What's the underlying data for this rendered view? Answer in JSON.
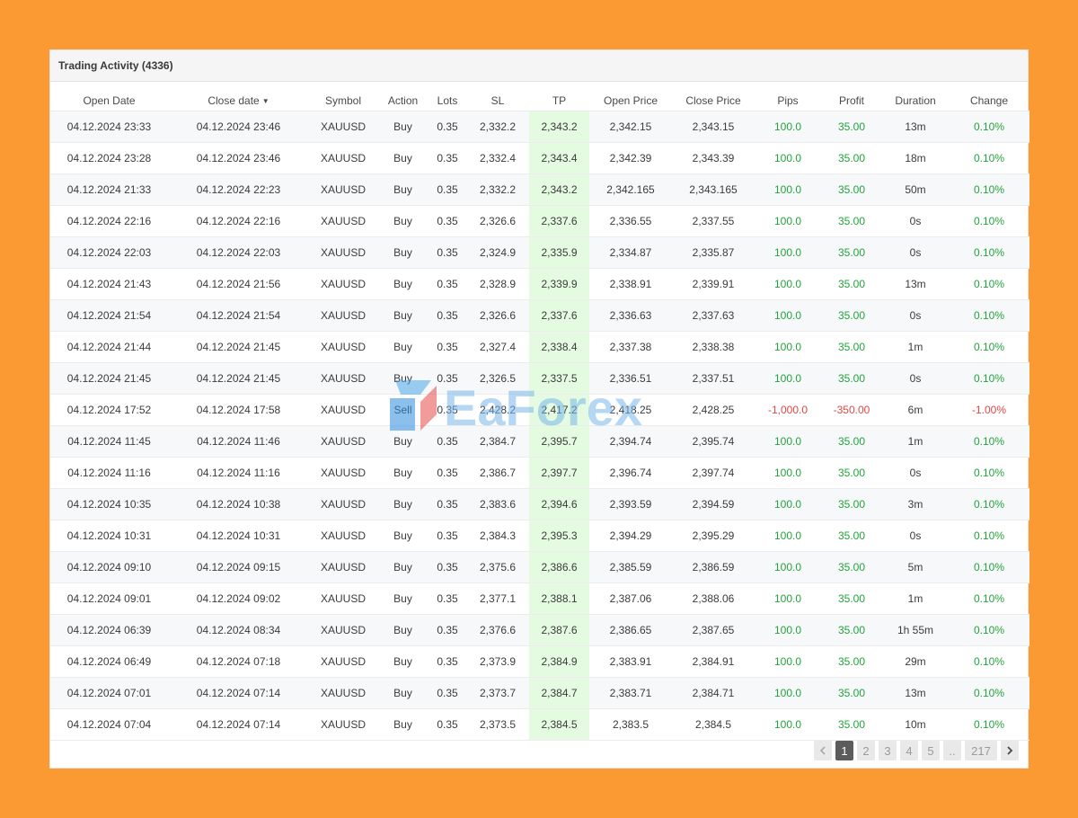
{
  "panel": {
    "title": "Trading Activity (4336)"
  },
  "table": {
    "columns": [
      "Open Date",
      "Close date",
      "Symbol",
      "Action",
      "Lots",
      "SL",
      "TP",
      "Open Price",
      "Close Price",
      "Pips",
      "Profit",
      "Duration",
      "Change"
    ],
    "sort_indicator": "▼",
    "rows": [
      [
        "04.12.2024 23:33",
        "04.12.2024 23:46",
        "XAUUSD",
        "Buy",
        "0.35",
        "2,332.2",
        "2,343.2",
        "2,342.15",
        "2,343.15",
        "100.0",
        "35.00",
        "13m",
        "0.10%"
      ],
      [
        "04.12.2024 23:28",
        "04.12.2024 23:46",
        "XAUUSD",
        "Buy",
        "0.35",
        "2,332.4",
        "2,343.4",
        "2,342.39",
        "2,343.39",
        "100.0",
        "35.00",
        "18m",
        "0.10%"
      ],
      [
        "04.12.2024 21:33",
        "04.12.2024 22:23",
        "XAUUSD",
        "Buy",
        "0.35",
        "2,332.2",
        "2,343.2",
        "2,342.165",
        "2,343.165",
        "100.0",
        "35.00",
        "50m",
        "0.10%"
      ],
      [
        "04.12.2024 22:16",
        "04.12.2024 22:16",
        "XAUUSD",
        "Buy",
        "0.35",
        "2,326.6",
        "2,337.6",
        "2,336.55",
        "2,337.55",
        "100.0",
        "35.00",
        "0s",
        "0.10%"
      ],
      [
        "04.12.2024 22:03",
        "04.12.2024 22:03",
        "XAUUSD",
        "Buy",
        "0.35",
        "2,324.9",
        "2,335.9",
        "2,334.87",
        "2,335.87",
        "100.0",
        "35.00",
        "0s",
        "0.10%"
      ],
      [
        "04.12.2024 21:43",
        "04.12.2024 21:56",
        "XAUUSD",
        "Buy",
        "0.35",
        "2,328.9",
        "2,339.9",
        "2,338.91",
        "2,339.91",
        "100.0",
        "35.00",
        "13m",
        "0.10%"
      ],
      [
        "04.12.2024 21:54",
        "04.12.2024 21:54",
        "XAUUSD",
        "Buy",
        "0.35",
        "2,326.6",
        "2,337.6",
        "2,336.63",
        "2,337.63",
        "100.0",
        "35.00",
        "0s",
        "0.10%"
      ],
      [
        "04.12.2024 21:44",
        "04.12.2024 21:45",
        "XAUUSD",
        "Buy",
        "0.35",
        "2,327.4",
        "2,338.4",
        "2,337.38",
        "2,338.38",
        "100.0",
        "35.00",
        "1m",
        "0.10%"
      ],
      [
        "04.12.2024 21:45",
        "04.12.2024 21:45",
        "XAUUSD",
        "Buy",
        "0.35",
        "2,326.5",
        "2,337.5",
        "2,336.51",
        "2,337.51",
        "100.0",
        "35.00",
        "0s",
        "0.10%"
      ],
      [
        "04.12.2024 17:52",
        "04.12.2024 17:58",
        "XAUUSD",
        "Sell",
        "0.35",
        "2,428.2",
        "2,417.2",
        "2,418.25",
        "2,428.25",
        "-1,000.0",
        "-350.00",
        "6m",
        "-1.00%"
      ],
      [
        "04.12.2024 11:45",
        "04.12.2024 11:46",
        "XAUUSD",
        "Buy",
        "0.35",
        "2,384.7",
        "2,395.7",
        "2,394.74",
        "2,395.74",
        "100.0",
        "35.00",
        "1m",
        "0.10%"
      ],
      [
        "04.12.2024 11:16",
        "04.12.2024 11:16",
        "XAUUSD",
        "Buy",
        "0.35",
        "2,386.7",
        "2,397.7",
        "2,396.74",
        "2,397.74",
        "100.0",
        "35.00",
        "0s",
        "0.10%"
      ],
      [
        "04.12.2024 10:35",
        "04.12.2024 10:38",
        "XAUUSD",
        "Buy",
        "0.35",
        "2,383.6",
        "2,394.6",
        "2,393.59",
        "2,394.59",
        "100.0",
        "35.00",
        "3m",
        "0.10%"
      ],
      [
        "04.12.2024 10:31",
        "04.12.2024 10:31",
        "XAUUSD",
        "Buy",
        "0.35",
        "2,384.3",
        "2,395.3",
        "2,394.29",
        "2,395.29",
        "100.0",
        "35.00",
        "0s",
        "0.10%"
      ],
      [
        "04.12.2024 09:10",
        "04.12.2024 09:15",
        "XAUUSD",
        "Buy",
        "0.35",
        "2,375.6",
        "2,386.6",
        "2,385.59",
        "2,386.59",
        "100.0",
        "35.00",
        "5m",
        "0.10%"
      ],
      [
        "04.12.2024 09:01",
        "04.12.2024 09:02",
        "XAUUSD",
        "Buy",
        "0.35",
        "2,377.1",
        "2,388.1",
        "2,387.06",
        "2,388.06",
        "100.0",
        "35.00",
        "1m",
        "0.10%"
      ],
      [
        "04.12.2024 06:39",
        "04.12.2024 08:34",
        "XAUUSD",
        "Buy",
        "0.35",
        "2,376.6",
        "2,387.6",
        "2,386.65",
        "2,387.65",
        "100.0",
        "35.00",
        "1h 55m",
        "0.10%"
      ],
      [
        "04.12.2024 06:49",
        "04.12.2024 07:18",
        "XAUUSD",
        "Buy",
        "0.35",
        "2,373.9",
        "2,384.9",
        "2,383.91",
        "2,384.91",
        "100.0",
        "35.00",
        "29m",
        "0.10%"
      ],
      [
        "04.12.2024 07:01",
        "04.12.2024 07:14",
        "XAUUSD",
        "Buy",
        "0.35",
        "2,373.7",
        "2,384.7",
        "2,383.71",
        "2,384.71",
        "100.0",
        "35.00",
        "13m",
        "0.10%"
      ],
      [
        "04.12.2024 07:04",
        "04.12.2024 07:14",
        "XAUUSD",
        "Buy",
        "0.35",
        "2,373.5",
        "2,384.5",
        "2,383.5",
        "2,384.5",
        "100.0",
        "35.00",
        "10m",
        "0.10%"
      ]
    ]
  },
  "pagination": {
    "prev_icon": "chevron-left-icon",
    "next_icon": "chevron-right-icon",
    "pages": [
      "1",
      "2",
      "3",
      "4",
      "5"
    ],
    "ellipsis": "..",
    "last": "217",
    "active": "1"
  },
  "watermark": {
    "text": "EaForex",
    "logo_icon": "eaforex-logo-icon"
  },
  "colors": {
    "background": "#fb9a32",
    "positive": "#22a43a",
    "negative": "#e24747",
    "tp_highlight": "#e4fbe1",
    "active_page": "#5c5c5c"
  }
}
